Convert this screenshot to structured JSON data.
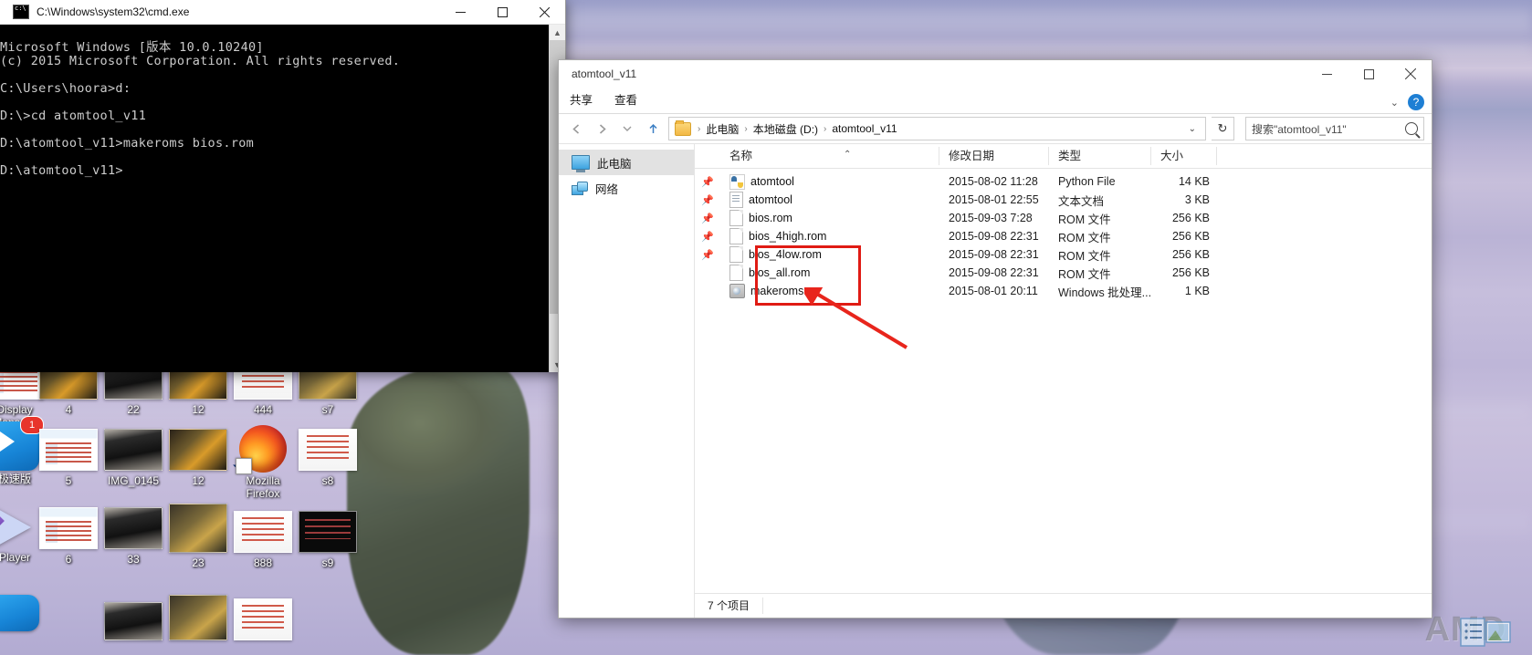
{
  "cmd_window": {
    "title": "C:\\Windows\\system32\\cmd.exe",
    "icon": "cmd-icon",
    "minimize_label": "–",
    "maximize_label": "□",
    "close_label": "✕",
    "console_text": "Microsoft Windows [版本 10.0.10240]\n(c) 2015 Microsoft Corporation. All rights reserved.\n\nC:\\Users\\hoora>d:\n\nD:\\>cd atomtool_v11\n\nD:\\atomtool_v11>makeroms bios.rom\n\nD:\\atomtool_v11>",
    "scroll_up": "▲",
    "scroll_down": "▼"
  },
  "explorer": {
    "title": "atomtool_v11",
    "minimize_label": "–",
    "maximize_label": "□",
    "close_label": "✕",
    "ribbon": {
      "tabs": [
        "共享",
        "查看"
      ],
      "collapse_label": "⌄",
      "help_label": "?"
    },
    "address": {
      "back_label": "←",
      "forward_label": "→",
      "up_label": "↑",
      "crumbs": [
        "此电脑",
        "本地磁盘 (D:)",
        "atomtool_v11"
      ],
      "separator": "›",
      "dropdown_label": "⌄",
      "refresh_label": "↻"
    },
    "search": {
      "placeholder": "搜索\"atomtool_v11\"",
      "icon": "search-icon"
    },
    "nav_pane": {
      "items": [
        {
          "label": "此电脑",
          "icon": "this-pc-icon",
          "selected": true
        },
        {
          "label": "网络",
          "icon": "network-icon",
          "selected": false
        }
      ]
    },
    "columns": {
      "name": "名称",
      "date": "修改日期",
      "type": "类型",
      "size": "大小",
      "sort_caret": "⌃"
    },
    "files": [
      {
        "name": "atomtool",
        "date": "2015-08-02 11:28",
        "type": "Python File",
        "size": "14 KB",
        "icon": "python-file-icon"
      },
      {
        "name": "atomtool",
        "date": "2015-08-01 22:55",
        "type": "文本文档",
        "size": "3 KB",
        "icon": "text-file-icon"
      },
      {
        "name": "bios.rom",
        "date": "2015-09-03 7:28",
        "type": "ROM 文件",
        "size": "256 KB",
        "icon": "generic-file-icon"
      },
      {
        "name": "bios_4high.rom",
        "date": "2015-09-08 22:31",
        "type": "ROM 文件",
        "size": "256 KB",
        "icon": "generic-file-icon"
      },
      {
        "name": "bios_4low.rom",
        "date": "2015-09-08 22:31",
        "type": "ROM 文件",
        "size": "256 KB",
        "icon": "generic-file-icon"
      },
      {
        "name": "bios_all.rom",
        "date": "2015-09-08 22:31",
        "type": "ROM 文件",
        "size": "256 KB",
        "icon": "generic-file-icon"
      },
      {
        "name": "makeroms",
        "date": "2015-08-01 20:11",
        "type": "Windows 批处理...",
        "size": "1 KB",
        "icon": "batch-file-icon"
      }
    ],
    "status_text": "7 个项目",
    "annotation": {
      "highlight_color": "#e01b14",
      "arrow_color": "#e8251c"
    }
  },
  "desktop": {
    "icons": [
      {
        "label": "Display\nManager",
        "thumb": "app-thumb",
        "row": 1,
        "col": 0
      },
      {
        "label": "4",
        "thumb": "photo-thumb",
        "row": 1,
        "col": 1
      },
      {
        "label": "22",
        "thumb": "dark-thumb",
        "row": 1,
        "col": 2
      },
      {
        "label": "12",
        "thumb": "photo-thumb",
        "row": 1,
        "col": 3
      },
      {
        "label": "444",
        "thumb": "doc-thumb",
        "row": 1,
        "col": 4
      },
      {
        "label": "s7",
        "thumb": "shot-thumb",
        "row": 1,
        "col": 5
      },
      {
        "label": "极速版",
        "thumb": "blue-app",
        "row": 2,
        "col": 0
      },
      {
        "label": "5",
        "thumb": "win-thumb",
        "row": 2,
        "col": 1
      },
      {
        "label": "IMG_0145",
        "thumb": "dark-thumb",
        "row": 2,
        "col": 2
      },
      {
        "label": "12",
        "thumb": "photo-thumb",
        "row": 2,
        "col": 3
      },
      {
        "label": "Mozilla\nFirefox",
        "thumb": "firefox",
        "row": 2,
        "col": 4
      },
      {
        "label": "s8",
        "thumb": "doc-thumb",
        "row": 2,
        "col": 5
      },
      {
        "label": "Player",
        "thumb": "player",
        "row": 3,
        "col": 0
      },
      {
        "label": "6",
        "thumb": "win-thumb",
        "row": 3,
        "col": 1
      },
      {
        "label": "33",
        "thumb": "dark-thumb",
        "row": 3,
        "col": 2
      },
      {
        "label": "23",
        "thumb": "shot-thumb",
        "row": 3,
        "col": 3
      },
      {
        "label": "888",
        "thumb": "doc-thumb",
        "row": 3,
        "col": 4
      },
      {
        "label": "s9",
        "thumb": "term-thumb",
        "row": 3,
        "col": 5
      }
    ],
    "badge_count": "1",
    "watermark": "AMD"
  }
}
